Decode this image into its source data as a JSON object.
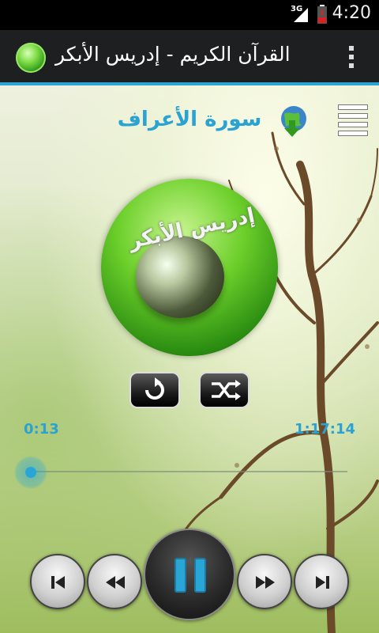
{
  "status_bar": {
    "network": "3G",
    "time": "4:20"
  },
  "action_bar": {
    "title": "القرآن الكريم - إدريس الأبكر"
  },
  "player": {
    "surah_title": "سورة الأعراف",
    "cover_text": "إدريس الأبكر",
    "time_elapsed": "0:13",
    "time_total": "1:17:14",
    "progress_fraction": 0.003
  },
  "colors": {
    "accent": "#2aa6d6",
    "action_bar_bg": "#1d1f21"
  },
  "icons": {
    "app": "quran-globe-icon",
    "download": "globe-download-icon",
    "playlist": "playlist-icon",
    "repeat": "repeat-icon",
    "shuffle": "shuffle-icon",
    "prev": "skip-previous-icon",
    "rewind": "rewind-icon",
    "pause": "pause-icon",
    "forward": "fast-forward-icon",
    "next": "skip-next-icon"
  }
}
